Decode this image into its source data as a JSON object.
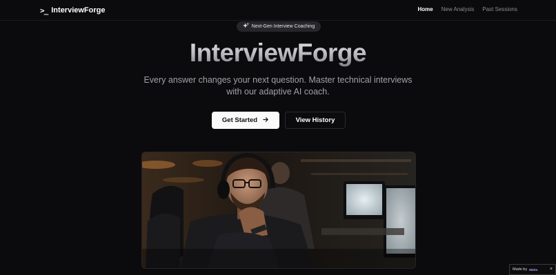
{
  "brand": {
    "icon": "terminal-icon",
    "glyph": ">_",
    "name": "InterviewForge"
  },
  "nav": {
    "links": [
      {
        "label": "Home",
        "active": true
      },
      {
        "label": "New Analysis",
        "active": false
      },
      {
        "label": "Past Sessions",
        "active": false
      }
    ]
  },
  "badge": {
    "icon": "sparkles-icon",
    "text": "Next-Gen Interview Coaching"
  },
  "hero": {
    "title": "InterviewForge",
    "subtitle": "Every answer changes your next question. Master technical interviews with our adaptive AI coach.",
    "primary_button": {
      "label": "Get Started",
      "icon": "arrow-right-icon"
    },
    "secondary_button": {
      "label": "View History"
    }
  },
  "made_by": {
    "text": "Made by",
    "logo": "MeDo",
    "close_icon": "close-icon"
  },
  "colors": {
    "background": "#0b0b0d",
    "primary_button": "#fafafa",
    "muted_text": "#a1a1aa"
  }
}
